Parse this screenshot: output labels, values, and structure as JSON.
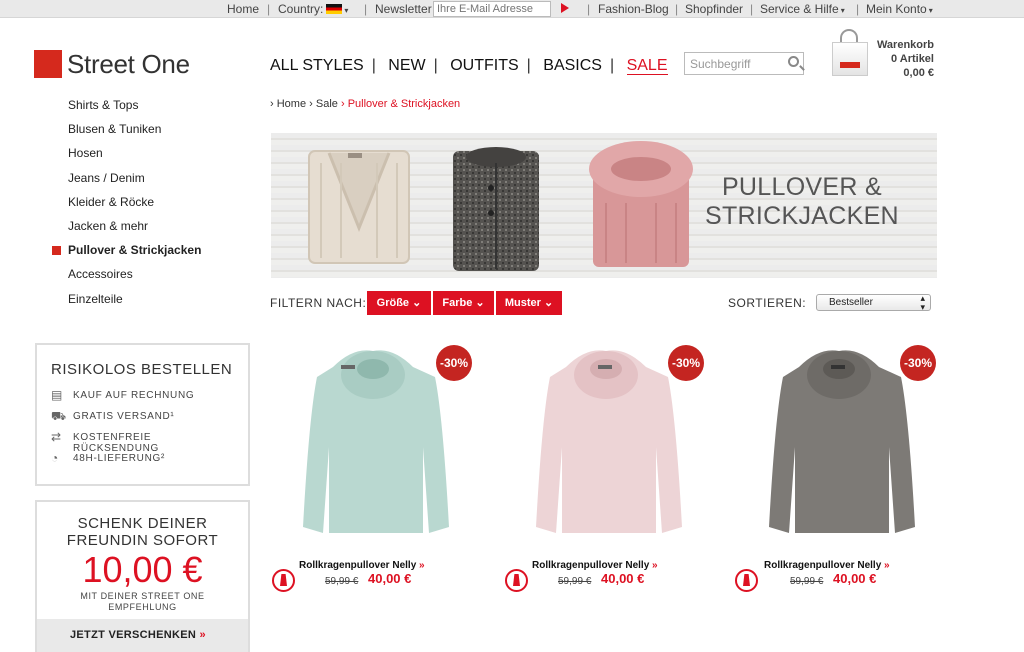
{
  "topbar": {
    "home": "Home",
    "country_label": "Country:",
    "newsletter": "Newsletter",
    "newsletter_placeholder": "Ihre E-Mail Adresse",
    "fashion_blog": "Fashion-Blog",
    "shopfinder": "Shopfinder",
    "service": "Service & Hilfe",
    "account": "Mein Konto",
    "colors": {
      "flag": [
        "#000000",
        "#dd0000",
        "#ffcc00"
      ]
    }
  },
  "header": {
    "logo": "Street One",
    "nav": [
      "ALL STYLES",
      "NEW",
      "OUTFITS",
      "BASICS",
      "SALE"
    ],
    "search_placeholder": "Suchbegriff",
    "cart": {
      "title": "Warenkorb",
      "count": "0 Artikel",
      "total": "0,00 €"
    },
    "brand_color": "#d5291d"
  },
  "sidebar": {
    "categories": [
      {
        "label": "Shirts & Tops"
      },
      {
        "label": "Blusen & Tuniken"
      },
      {
        "label": "Hosen"
      },
      {
        "label": "Jeans / Denim"
      },
      {
        "label": "Kleider & Röcke"
      },
      {
        "label": "Jacken & mehr"
      },
      {
        "label": "Pullover & Strickjacken",
        "active": true
      },
      {
        "label": "Accessoires"
      },
      {
        "label": "Einzelteile"
      }
    ],
    "risk_box": {
      "title": "RISIKOLOS BESTELLEN",
      "items": [
        {
          "label": "KAUF AUF RECHNUNG",
          "icon": "document-icon"
        },
        {
          "label": "GRATIS VERSAND¹",
          "icon": "truck-icon"
        },
        {
          "label": "KOSTENFREIE RÜCKSENDUNG",
          "icon": "return-arrows-icon"
        },
        {
          "label": "48H-LIEFERUNG²",
          "icon": "clock-icon"
        }
      ]
    },
    "gift_box": {
      "line1": "SCHENK DEINER",
      "line2": "FREUNDIN SOFORT",
      "amount": "10,00 €",
      "sub1": "MIT DEINER STREET ONE",
      "sub2": "EMPFEHLUNG",
      "cta": "JETZT VERSCHENKEN",
      "cta_arrows": "»"
    }
  },
  "breadcrumb": [
    "Home",
    "Sale",
    "Pullover & Strickjacken"
  ],
  "banner": {
    "line1": "PULLOVER &",
    "line2": "STRICKJACKEN"
  },
  "filters": {
    "label": "FILTERN NACH:",
    "buttons": [
      "Größe",
      "Farbe",
      "Muster"
    ],
    "sort_label": "SORTIEREN:",
    "sort_value": "Bestseller"
  },
  "products": [
    {
      "name": "Rollkragenpullover Nelly",
      "old_price": "59,99 €",
      "price": "40,00 €",
      "discount": "-30%",
      "color": "#b9d8d0"
    },
    {
      "name": "Rollkragenpullover Nelly",
      "old_price": "59,99 €",
      "price": "40,00 €",
      "discount": "-30%",
      "color": "#edd4d6"
    },
    {
      "name": "Rollkragenpullover Nelly",
      "old_price": "59,99 €",
      "price": "40,00 €",
      "discount": "-30%",
      "color": "#7d7a76"
    }
  ]
}
